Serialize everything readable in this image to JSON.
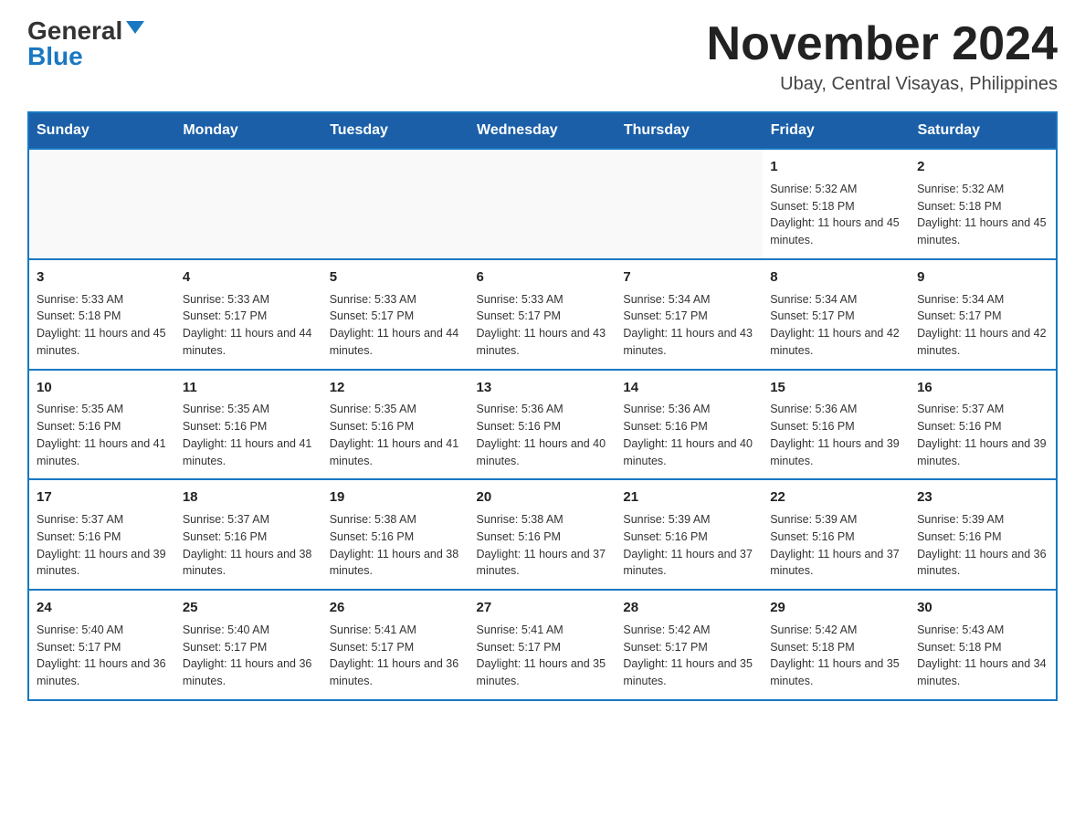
{
  "header": {
    "logo_general": "General",
    "logo_blue": "Blue",
    "month_title": "November 2024",
    "location": "Ubay, Central Visayas, Philippines"
  },
  "days_of_week": [
    "Sunday",
    "Monday",
    "Tuesday",
    "Wednesday",
    "Thursday",
    "Friday",
    "Saturday"
  ],
  "weeks": [
    [
      {
        "day": "",
        "info": ""
      },
      {
        "day": "",
        "info": ""
      },
      {
        "day": "",
        "info": ""
      },
      {
        "day": "",
        "info": ""
      },
      {
        "day": "",
        "info": ""
      },
      {
        "day": "1",
        "info": "Sunrise: 5:32 AM\nSunset: 5:18 PM\nDaylight: 11 hours and 45 minutes."
      },
      {
        "day": "2",
        "info": "Sunrise: 5:32 AM\nSunset: 5:18 PM\nDaylight: 11 hours and 45 minutes."
      }
    ],
    [
      {
        "day": "3",
        "info": "Sunrise: 5:33 AM\nSunset: 5:18 PM\nDaylight: 11 hours and 45 minutes."
      },
      {
        "day": "4",
        "info": "Sunrise: 5:33 AM\nSunset: 5:17 PM\nDaylight: 11 hours and 44 minutes."
      },
      {
        "day": "5",
        "info": "Sunrise: 5:33 AM\nSunset: 5:17 PM\nDaylight: 11 hours and 44 minutes."
      },
      {
        "day": "6",
        "info": "Sunrise: 5:33 AM\nSunset: 5:17 PM\nDaylight: 11 hours and 43 minutes."
      },
      {
        "day": "7",
        "info": "Sunrise: 5:34 AM\nSunset: 5:17 PM\nDaylight: 11 hours and 43 minutes."
      },
      {
        "day": "8",
        "info": "Sunrise: 5:34 AM\nSunset: 5:17 PM\nDaylight: 11 hours and 42 minutes."
      },
      {
        "day": "9",
        "info": "Sunrise: 5:34 AM\nSunset: 5:17 PM\nDaylight: 11 hours and 42 minutes."
      }
    ],
    [
      {
        "day": "10",
        "info": "Sunrise: 5:35 AM\nSunset: 5:16 PM\nDaylight: 11 hours and 41 minutes."
      },
      {
        "day": "11",
        "info": "Sunrise: 5:35 AM\nSunset: 5:16 PM\nDaylight: 11 hours and 41 minutes."
      },
      {
        "day": "12",
        "info": "Sunrise: 5:35 AM\nSunset: 5:16 PM\nDaylight: 11 hours and 41 minutes."
      },
      {
        "day": "13",
        "info": "Sunrise: 5:36 AM\nSunset: 5:16 PM\nDaylight: 11 hours and 40 minutes."
      },
      {
        "day": "14",
        "info": "Sunrise: 5:36 AM\nSunset: 5:16 PM\nDaylight: 11 hours and 40 minutes."
      },
      {
        "day": "15",
        "info": "Sunrise: 5:36 AM\nSunset: 5:16 PM\nDaylight: 11 hours and 39 minutes."
      },
      {
        "day": "16",
        "info": "Sunrise: 5:37 AM\nSunset: 5:16 PM\nDaylight: 11 hours and 39 minutes."
      }
    ],
    [
      {
        "day": "17",
        "info": "Sunrise: 5:37 AM\nSunset: 5:16 PM\nDaylight: 11 hours and 39 minutes."
      },
      {
        "day": "18",
        "info": "Sunrise: 5:37 AM\nSunset: 5:16 PM\nDaylight: 11 hours and 38 minutes."
      },
      {
        "day": "19",
        "info": "Sunrise: 5:38 AM\nSunset: 5:16 PM\nDaylight: 11 hours and 38 minutes."
      },
      {
        "day": "20",
        "info": "Sunrise: 5:38 AM\nSunset: 5:16 PM\nDaylight: 11 hours and 37 minutes."
      },
      {
        "day": "21",
        "info": "Sunrise: 5:39 AM\nSunset: 5:16 PM\nDaylight: 11 hours and 37 minutes."
      },
      {
        "day": "22",
        "info": "Sunrise: 5:39 AM\nSunset: 5:16 PM\nDaylight: 11 hours and 37 minutes."
      },
      {
        "day": "23",
        "info": "Sunrise: 5:39 AM\nSunset: 5:16 PM\nDaylight: 11 hours and 36 minutes."
      }
    ],
    [
      {
        "day": "24",
        "info": "Sunrise: 5:40 AM\nSunset: 5:17 PM\nDaylight: 11 hours and 36 minutes."
      },
      {
        "day": "25",
        "info": "Sunrise: 5:40 AM\nSunset: 5:17 PM\nDaylight: 11 hours and 36 minutes."
      },
      {
        "day": "26",
        "info": "Sunrise: 5:41 AM\nSunset: 5:17 PM\nDaylight: 11 hours and 36 minutes."
      },
      {
        "day": "27",
        "info": "Sunrise: 5:41 AM\nSunset: 5:17 PM\nDaylight: 11 hours and 35 minutes."
      },
      {
        "day": "28",
        "info": "Sunrise: 5:42 AM\nSunset: 5:17 PM\nDaylight: 11 hours and 35 minutes."
      },
      {
        "day": "29",
        "info": "Sunrise: 5:42 AM\nSunset: 5:18 PM\nDaylight: 11 hours and 35 minutes."
      },
      {
        "day": "30",
        "info": "Sunrise: 5:43 AM\nSunset: 5:18 PM\nDaylight: 11 hours and 34 minutes."
      }
    ]
  ]
}
